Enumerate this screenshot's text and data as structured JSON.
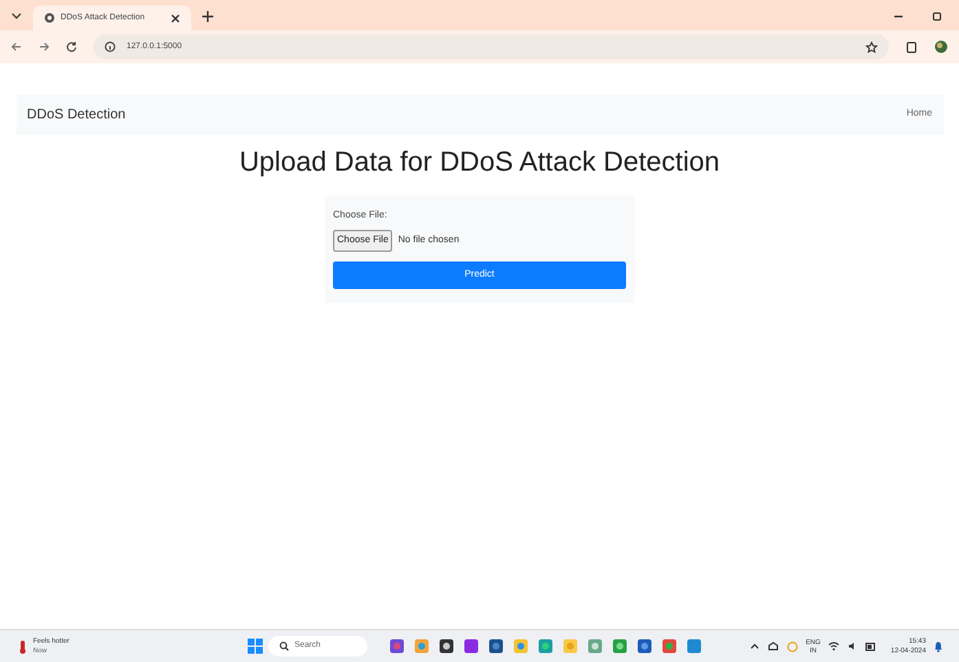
{
  "browser": {
    "tab": {
      "title": "DDoS Attack Detection",
      "selected": true
    },
    "url": "127.0.0.1:5000"
  },
  "navbar": {
    "brand": "DDoS Detection",
    "links": [
      "Home"
    ]
  },
  "heading": "Upload Data for DDoS Attack Detection",
  "form": {
    "label": "Choose File:",
    "file_button": "Choose File",
    "file_status": "No file chosen",
    "submit": "Predict"
  },
  "taskbar": {
    "weather": {
      "title": "Feels hotter",
      "subtitle": "Now"
    },
    "search_placeholder": "Search",
    "language": [
      "ENG",
      "IN"
    ],
    "time": "15:43",
    "date": "12-04-2024"
  }
}
